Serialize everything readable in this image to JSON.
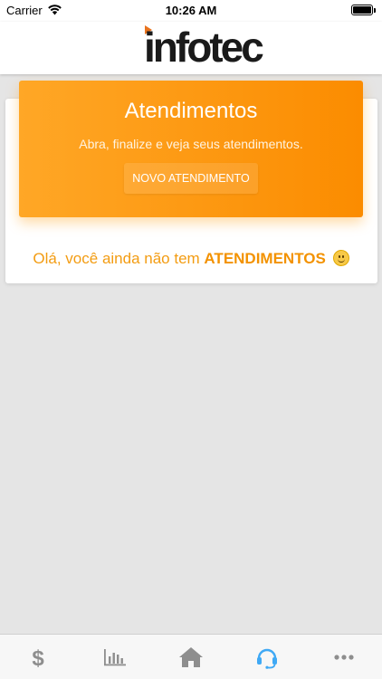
{
  "status_bar": {
    "carrier": "Carrier",
    "time": "10:26 AM"
  },
  "header": {
    "logo_text": "infotec"
  },
  "hero": {
    "title": "Atendimentos",
    "subtitle": "Abra, finalize e veja seus atendimentos.",
    "button_label": "NOVO ATENDIMENTO"
  },
  "empty_state": {
    "prefix": "Olá, você ainda não tem",
    "highlight": "ATENDIMENTOS"
  },
  "tab_bar": {
    "tabs": [
      {
        "icon": "dollar-icon",
        "active": false
      },
      {
        "icon": "bar-chart-icon",
        "active": false
      },
      {
        "icon": "home-icon",
        "active": false
      },
      {
        "icon": "headset-icon",
        "active": true
      },
      {
        "icon": "more-icon",
        "active": false
      }
    ]
  },
  "colors": {
    "accent": "#fb8c00",
    "accent_light": "#ffa726",
    "tab_active": "#3fa9f5",
    "tab_inactive": "#8e8e8e"
  }
}
